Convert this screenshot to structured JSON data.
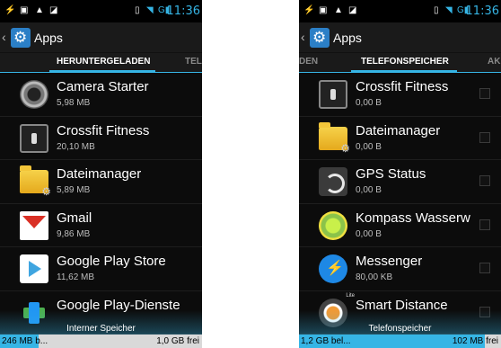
{
  "status": {
    "time": "11:36",
    "left_icons": [
      "usb-icon",
      "image-icon",
      "warning-icon",
      "sd-card-icon"
    ],
    "right_icons": [
      "vibrate-icon",
      "wifi-icon",
      "signal-icon",
      "battery-icon"
    ]
  },
  "accent_color": "#36b5e5",
  "left": {
    "title": "Apps",
    "tabs": [
      {
        "label": "HERUNTERGELADEN",
        "active": true
      },
      {
        "label": "TEL",
        "active": false
      }
    ],
    "apps": [
      {
        "name": "Camera Starter",
        "size": "5,98 MB",
        "icon": "camera-icon"
      },
      {
        "name": "Crossfit Fitness",
        "size": "20,10 MB",
        "icon": "crossfit-icon"
      },
      {
        "name": "Dateimanager",
        "size": "5,89 MB",
        "icon": "folder-icon"
      },
      {
        "name": "Gmail",
        "size": "9,86 MB",
        "icon": "gmail-icon"
      },
      {
        "name": "Google Play Store",
        "size": "11,62 MB",
        "icon": "play-store-icon"
      },
      {
        "name": "Google Play-Dienste",
        "size": "",
        "icon": "play-services-icon"
      }
    ],
    "storage": {
      "label": "Interner Speicher",
      "used": "246 MB b...",
      "free": "1,0 GB frei",
      "used_fraction": 0.19
    }
  },
  "right": {
    "title": "Apps",
    "tabs": [
      {
        "label": "DEN",
        "active": false
      },
      {
        "label": "TELEFONSPEICHER",
        "active": true
      },
      {
        "label": "AK",
        "active": false
      }
    ],
    "apps": [
      {
        "name": "Crossfit Fitness",
        "size": "0,00 B",
        "icon": "crossfit-icon"
      },
      {
        "name": "Dateimanager",
        "size": "0,00 B",
        "icon": "folder-icon"
      },
      {
        "name": "GPS Status",
        "size": "0,00 B",
        "icon": "gps-status-icon"
      },
      {
        "name": "Kompass Wasserw",
        "size": "0,00 B",
        "icon": "compass-icon"
      },
      {
        "name": "Messenger",
        "size": "80,00 KB",
        "icon": "messenger-icon"
      },
      {
        "name": "Smart Distance",
        "size": "",
        "icon": "smart-distance-icon"
      }
    ],
    "storage": {
      "label": "Telefonspeicher",
      "used": "1,2 GB bel...",
      "free": "102 MB frei",
      "used_fraction": 0.92
    }
  }
}
